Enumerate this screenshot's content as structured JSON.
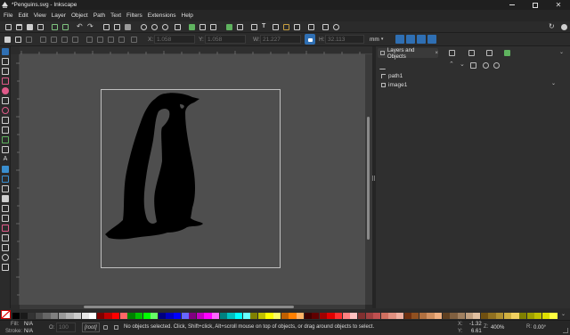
{
  "window": {
    "title": "*Penguins.svg - Inkscape",
    "controls": [
      "minimize",
      "maximize",
      "close"
    ]
  },
  "menu": [
    "File",
    "Edit",
    "View",
    "Layer",
    "Object",
    "Path",
    "Text",
    "Filters",
    "Extensions",
    "Help"
  ],
  "toolbar": {
    "x_label": "X:",
    "x_value": "1.058",
    "y_label": "Y:",
    "y_value": "1.058",
    "w_label": "W:",
    "w_value": "21.227",
    "h_label": "H:",
    "h_value": "32.113",
    "unit": "mm"
  },
  "dock": {
    "tab_label": "Layers and Objects",
    "close_glyph": "×",
    "items": [
      {
        "label": "path1",
        "type": "path"
      },
      {
        "label": "image1",
        "type": "image"
      }
    ]
  },
  "status": {
    "fill_label": "Fill:",
    "fill_value": "N/A",
    "stroke_label": "Stroke:",
    "stroke_value": "N/A",
    "opacity_label": "O:",
    "opacity_value": "100",
    "layer_value": "[root]",
    "message": "No objects selected. Click, Shift+click, Alt+scroll mouse on top of objects, or drag around objects to select.",
    "cursor_x_label": "X:",
    "cursor_x": "-1.32",
    "cursor_y_label": "Y:",
    "cursor_y": "6.61",
    "zoom_label": "Z:",
    "zoom_value": "400%",
    "rotate_label": "R:",
    "rotate_value": "0.00°"
  },
  "colors": {
    "accent": "#2f6fb3",
    "canvas": "#4e4e4e",
    "page_border": "#bfbfbf"
  },
  "palette": [
    "#000000",
    "#1a1a1a",
    "#333333",
    "#4d4d4d",
    "#666666",
    "#808080",
    "#999999",
    "#b3b3b3",
    "#cccccc",
    "#e6e6e6",
    "#ffffff",
    "#800000",
    "#c00000",
    "#ff0000",
    "#ff6666",
    "#008000",
    "#00c000",
    "#00ff00",
    "#66ff66",
    "#000080",
    "#0000c0",
    "#0000ff",
    "#6666ff",
    "#800080",
    "#c000c0",
    "#ff00ff",
    "#ff66ff",
    "#008080",
    "#00c0c0",
    "#00ffff",
    "#66ffff",
    "#808000",
    "#c0c000",
    "#ffff00",
    "#ffff66",
    "#c06000",
    "#ff8000",
    "#ffb366",
    "#400000",
    "#600000",
    "#a00000",
    "#e00000",
    "#ff3030",
    "#ff8080",
    "#ffc0c0",
    "#803030",
    "#a04040",
    "#c05050",
    "#d07060",
    "#e09080",
    "#f0b0a0",
    "#703010",
    "#905020",
    "#b07040",
    "#d09060",
    "#f0b080",
    "#604020",
    "#806040",
    "#a08060",
    "#c0a080",
    "#e0c0a0",
    "#705010",
    "#907020",
    "#b09030",
    "#d0b040",
    "#f0d060",
    "#808000",
    "#a0a000",
    "#c0c000",
    "#e0e000",
    "#ffff40"
  ]
}
